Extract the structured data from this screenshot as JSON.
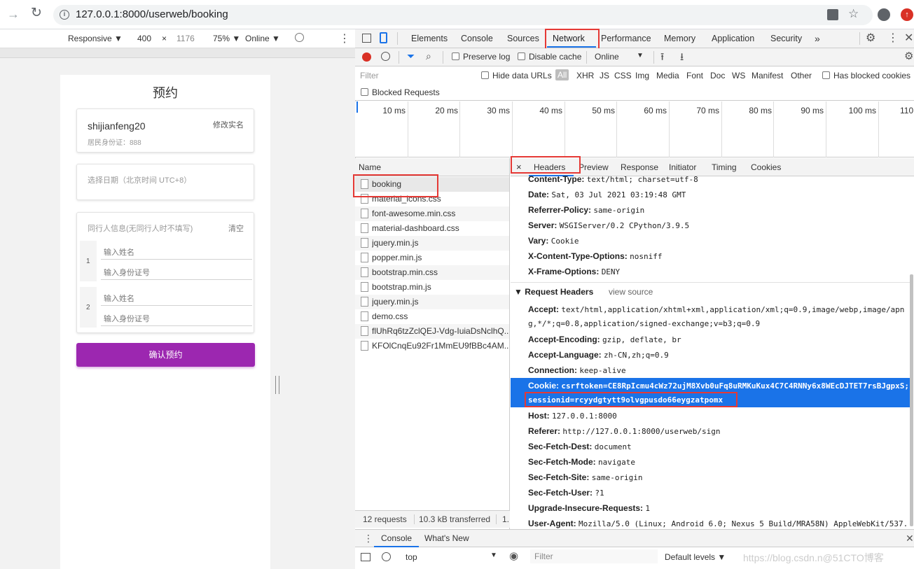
{
  "browser": {
    "url": "127.0.0.1:8000/userweb/booking"
  },
  "device_toolbar": {
    "mode": "Responsive ▼",
    "width": "400",
    "times": "×",
    "height": "1176",
    "zoom": "75% ▼",
    "throttle": "Online ▼"
  },
  "page": {
    "title": "预约",
    "name": "shijianfeng20",
    "id_label": "居民身份证：888",
    "edit_name": "修改实名",
    "date_placeholder": "选择日期（北京时间 UTC+8）",
    "companion_title": "同行人信息(无同行人时不填写)",
    "clear": "清空",
    "companions": [
      {
        "num": "1",
        "name_ph": "输入姓名",
        "id_ph": "输入身份证号"
      },
      {
        "num": "2",
        "name_ph": "输入姓名",
        "id_ph": "输入身份证号"
      }
    ],
    "confirm": "确认预约",
    "accent": "#9c27b0"
  },
  "devtools": {
    "tabs": [
      "Elements",
      "Console",
      "Sources",
      "Network",
      "Performance",
      "Memory",
      "Application",
      "Security",
      "»"
    ],
    "active_tab": "Network",
    "toolbar": {
      "preserve_log": "Preserve log",
      "disable_cache": "Disable cache",
      "online": "Online",
      "online_arrow": "▼"
    },
    "filter": {
      "placeholder": "Filter",
      "hide_data_urls": "Hide data URLs",
      "types": [
        "All",
        "XHR",
        "JS",
        "CSS",
        "Img",
        "Media",
        "Font",
        "Doc",
        "WS",
        "Manifest",
        "Other"
      ],
      "has_blocked": "Has blocked cookies",
      "blocked_requests": "Blocked Requests"
    },
    "timeline_ticks": [
      "10 ms",
      "20 ms",
      "30 ms",
      "40 ms",
      "50 ms",
      "60 ms",
      "70 ms",
      "80 ms",
      "90 ms",
      "100 ms",
      "110"
    ],
    "list_header": "Name",
    "files": [
      "booking",
      "material_icons.css",
      "font-awesome.min.css",
      "material-dashboard.css",
      "jquery.min.js",
      "popper.min.js",
      "bootstrap.min.css",
      "bootstrap.min.js",
      "jquery.min.js",
      "demo.css",
      "flUhRq6tzZclQEJ-Vdg-IuiaDsNclhQ...",
      "KFOlCnqEu92Fr1MmEU9fBBc4AM..."
    ],
    "status": {
      "requests": "12 requests",
      "transferred": "10.3 kB transferred",
      "more": "1."
    },
    "detail_tabs": [
      "×",
      "Headers",
      "Preview",
      "Response",
      "Initiator",
      "Timing",
      "Cookies"
    ],
    "response_headers": [
      {
        "k": "Content-Type:",
        "v": "text/html; charset=utf-8"
      },
      {
        "k": "Date:",
        "v": "Sat, 03 Jul 2021 03:19:48 GMT"
      },
      {
        "k": "Referrer-Policy:",
        "v": "same-origin"
      },
      {
        "k": "Server:",
        "v": "WSGIServer/0.2 CPython/3.9.5"
      },
      {
        "k": "Vary:",
        "v": "Cookie"
      },
      {
        "k": "X-Content-Type-Options:",
        "v": "nosniff"
      },
      {
        "k": "X-Frame-Options:",
        "v": "DENY"
      }
    ],
    "request_section": "▼ Request Headers",
    "view_source": "view source",
    "accept_k": "Accept:",
    "accept_v1": "text/html,application/xhtml+xml,application/xml;q=0.9,image/webp,image/apn",
    "accept_v2": "g,*/*;q=0.8,application/signed-exchange;v=b3;q=0.9",
    "req_headers_a": [
      {
        "k": "Accept-Encoding:",
        "v": "gzip, deflate, br"
      },
      {
        "k": "Accept-Language:",
        "v": "zh-CN,zh;q=0.9"
      },
      {
        "k": "Connection:",
        "v": "keep-alive"
      }
    ],
    "cookie_k": "Cookie:",
    "cookie_v1": "csrftoken=CE8RpIcmu4cWz72ujM8Xvb0uFq8uRMKuKux4C7C4RNNy6x8WEcDJTET7rsBJgpxS;",
    "cookie_v2": "sessionid=rcyydgtytt9olvgpusdo66eygzatpomx",
    "req_headers_b": [
      {
        "k": "Host:",
        "v": "127.0.0.1:8000"
      },
      {
        "k": "Referer:",
        "v": "http://127.0.0.1:8000/userweb/sign"
      },
      {
        "k": "Sec-Fetch-Dest:",
        "v": "document"
      },
      {
        "k": "Sec-Fetch-Mode:",
        "v": "navigate"
      },
      {
        "k": "Sec-Fetch-Site:",
        "v": "same-origin"
      },
      {
        "k": "Sec-Fetch-User:",
        "v": "?1"
      },
      {
        "k": "Upgrade-Insecure-Requests:",
        "v": "1"
      },
      {
        "k": "User-Agent:",
        "v": "Mozilla/5.0 (Linux; Android 6.0; Nexus 5 Build/MRA58N) AppleWebKit/537."
      }
    ],
    "drawer_tabs": [
      "Console",
      "What's New"
    ],
    "console_context": "top",
    "console_filter": "Filter",
    "default_levels": "Default levels ▼"
  },
  "watermark": "https://blog.csdn.n@51CTO博客",
  "colors": {
    "selection": "#1a73e8",
    "highlight_box": "#e53935"
  }
}
